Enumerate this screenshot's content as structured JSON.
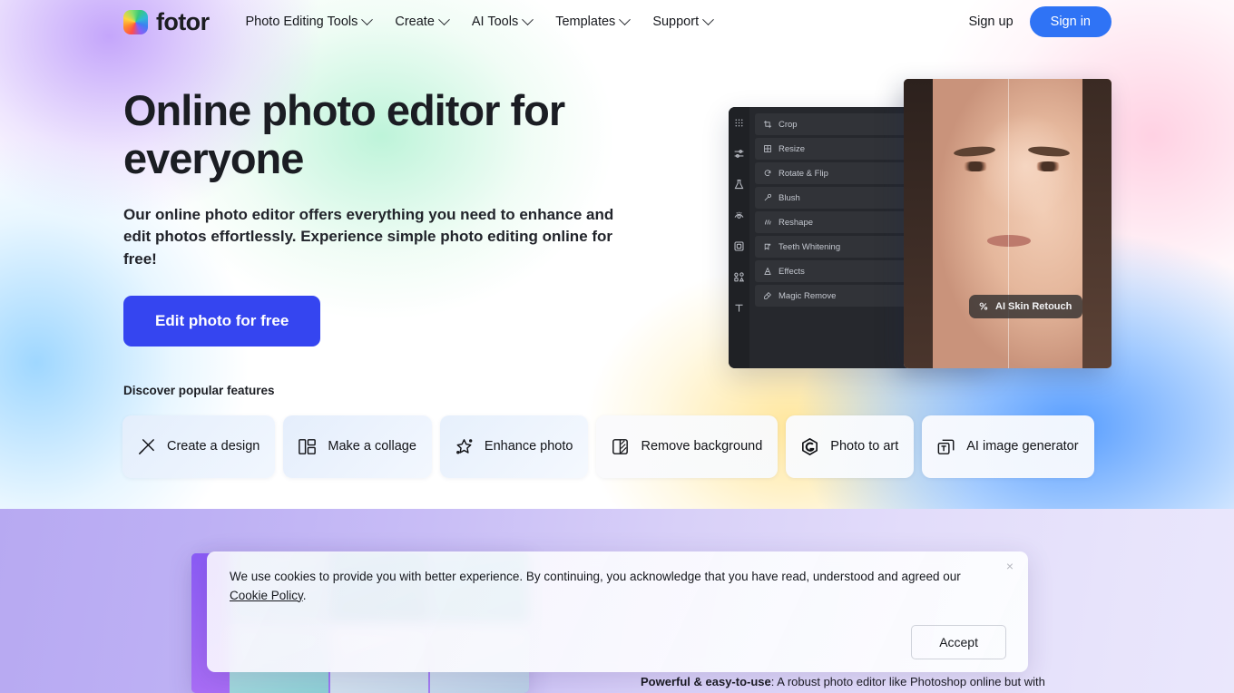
{
  "nav": {
    "logo_text": "fotor",
    "items": [
      {
        "label": "Photo Editing Tools"
      },
      {
        "label": "Create"
      },
      {
        "label": "AI Tools"
      },
      {
        "label": "Templates"
      },
      {
        "label": "Support"
      }
    ],
    "sign_up": "Sign up",
    "sign_in": "Sign in"
  },
  "hero": {
    "title": "Online photo editor for everyone",
    "subtitle": "Our online photo editor offers everything you need to enhance and edit photos effortlessly. Experience simple photo editing online for free!",
    "cta_label": "Edit photo for free"
  },
  "features": {
    "label": "Discover popular features",
    "items": [
      {
        "label": "Create a design",
        "icon": "wand-icon"
      },
      {
        "label": "Make a collage",
        "icon": "collage-grid-icon"
      },
      {
        "label": "Enhance photo",
        "icon": "sparkle-star-icon"
      },
      {
        "label": "Remove background",
        "icon": "background-remove-icon"
      },
      {
        "label": "Photo to art",
        "icon": "art-hexagon-icon"
      },
      {
        "label": "AI image generator",
        "icon": "ai-image-stack-icon"
      }
    ]
  },
  "editor_mockup": {
    "menu_items": [
      {
        "label": "Crop"
      },
      {
        "label": "Resize"
      },
      {
        "label": "Rotate & Flip"
      },
      {
        "label": "Blush"
      },
      {
        "label": "Reshape"
      },
      {
        "label": "Teeth Whitening"
      },
      {
        "label": "Effects"
      },
      {
        "label": "Magic Remove"
      }
    ],
    "badge_label": "AI Skin Retouch"
  },
  "lower": {
    "paragraph_lead": "Powerful & easy-to-use",
    "paragraph_rest": ": A robust photo editor like Photoshop online but with"
  },
  "cookie": {
    "text_before": "We use cookies to provide you with better experience. By continuing, you acknowledge that you have read, understood and agreed our ",
    "link_label": "Cookie Policy",
    "text_after": ".",
    "accept_label": "Accept",
    "close_label": "×"
  },
  "colors": {
    "primary_blue": "#2f73f5",
    "cta_indigo": "#3545f0",
    "text_dark": "#1b1d23",
    "lower_purple": "#b7a9f2"
  }
}
